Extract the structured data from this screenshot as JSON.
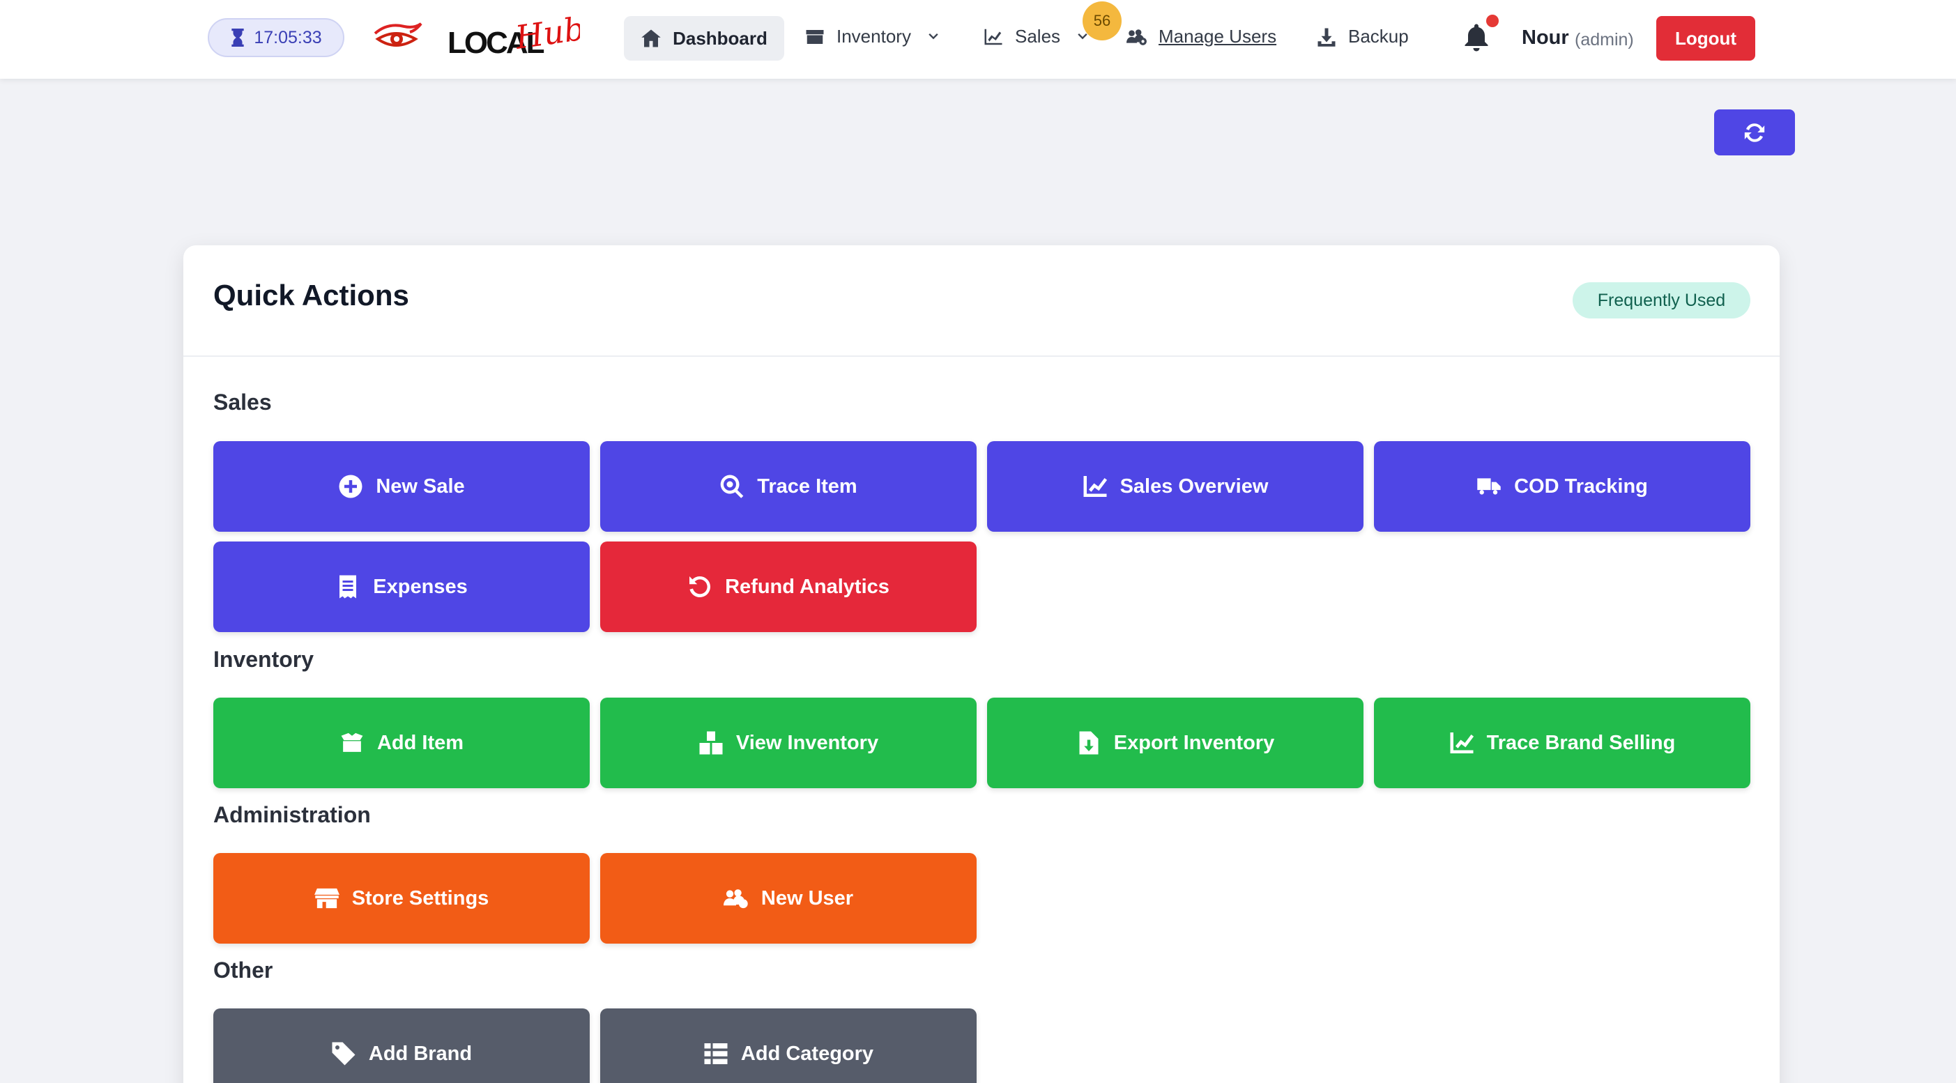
{
  "header": {
    "timer": "17:05:33",
    "brand": "LOCALHub",
    "nav": {
      "dashboard": "Dashboard",
      "inventory": "Inventory",
      "sales": "Sales",
      "sales_badge": "56",
      "manage_users": "Manage Users",
      "backup": "Backup"
    },
    "user": {
      "name": "Nour",
      "role": "(admin)"
    },
    "logout": "Logout"
  },
  "quick_actions": {
    "title": "Quick Actions",
    "badge": "Frequently Used",
    "sections": {
      "sales": {
        "label": "Sales",
        "buttons": [
          "New Sale",
          "Trace Item",
          "Sales Overview",
          "COD Tracking",
          "Expenses",
          "Refund Analytics"
        ]
      },
      "inventory": {
        "label": "Inventory",
        "buttons": [
          "Add Item",
          "View Inventory",
          "Export Inventory",
          "Trace Brand Selling"
        ]
      },
      "administration": {
        "label": "Administration",
        "buttons": [
          "Store Settings",
          "New User"
        ]
      },
      "other": {
        "label": "Other",
        "buttons": [
          "Add Brand",
          "Add Category"
        ]
      }
    }
  },
  "colors": {
    "primary": "#4f46e5",
    "danger": "#e5283a",
    "success": "#22bc4c",
    "warning": "#f25c16",
    "neutral": "#565c6a",
    "badge": "#f4b83e"
  },
  "icons": {
    "timer": "hourglass-icon",
    "dashboard": "home-icon",
    "inventory": "box-icon",
    "sales": "chart-line-icon",
    "users": "users-cog-icon",
    "backup": "download-icon",
    "notifications": "bell-icon",
    "refresh": "refresh-icon"
  }
}
